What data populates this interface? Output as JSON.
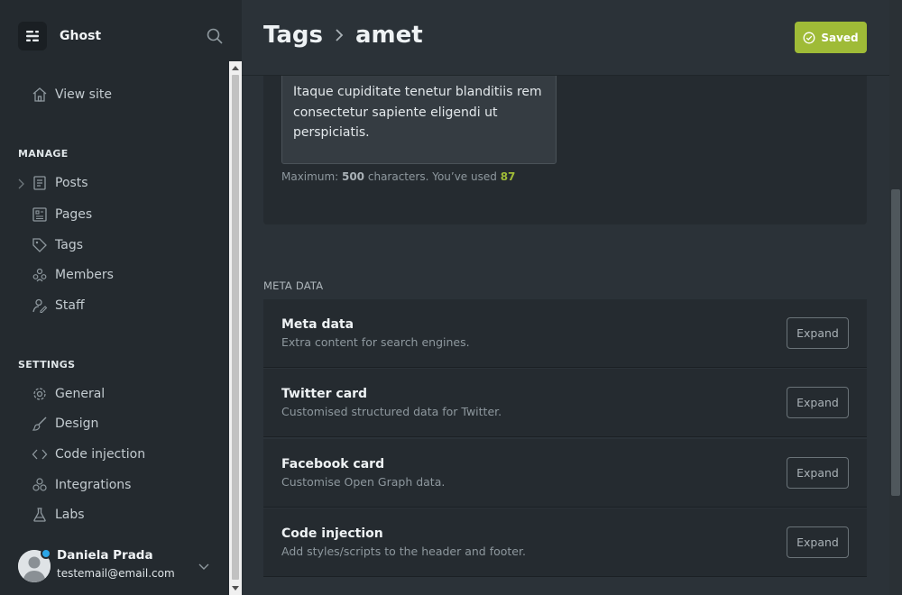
{
  "sidebar": {
    "brand": "Ghost",
    "view_site": "View site",
    "manage_title": "MANAGE",
    "manage_items": [
      "Posts",
      "Pages",
      "Tags",
      "Members",
      "Staff"
    ],
    "settings_title": "SETTINGS",
    "settings_items": [
      "General",
      "Design",
      "Code injection",
      "Integrations",
      "Labs"
    ],
    "user": {
      "name": "Daniela Prada",
      "email": "testemail@email.com"
    }
  },
  "header": {
    "crumb_parent": "Tags",
    "crumb_current": "amet",
    "saved_label": "Saved"
  },
  "description": {
    "value": "Itaque cupiditate tenetur blanditiis rem consectetur sapiente eligendi ut perspiciatis.",
    "hint_prefix": "Maximum: ",
    "hint_max": "500",
    "hint_middle": " characters. You’ve used ",
    "hint_used": "87"
  },
  "meta_section": {
    "title": "META DATA",
    "rows": [
      {
        "title": "Meta data",
        "desc": "Extra content for search engines.",
        "button": "Expand"
      },
      {
        "title": "Twitter card",
        "desc": "Customised structured data for Twitter.",
        "button": "Expand"
      },
      {
        "title": "Facebook card",
        "desc": "Customise Open Graph data.",
        "button": "Expand"
      },
      {
        "title": "Code injection",
        "desc": "Add styles/scripts to the header and footer.",
        "button": "Expand"
      }
    ]
  },
  "colors": {
    "accent": "#9fbb37",
    "sidebar_bg": "#242a2f",
    "main_bg": "#2b3238"
  }
}
